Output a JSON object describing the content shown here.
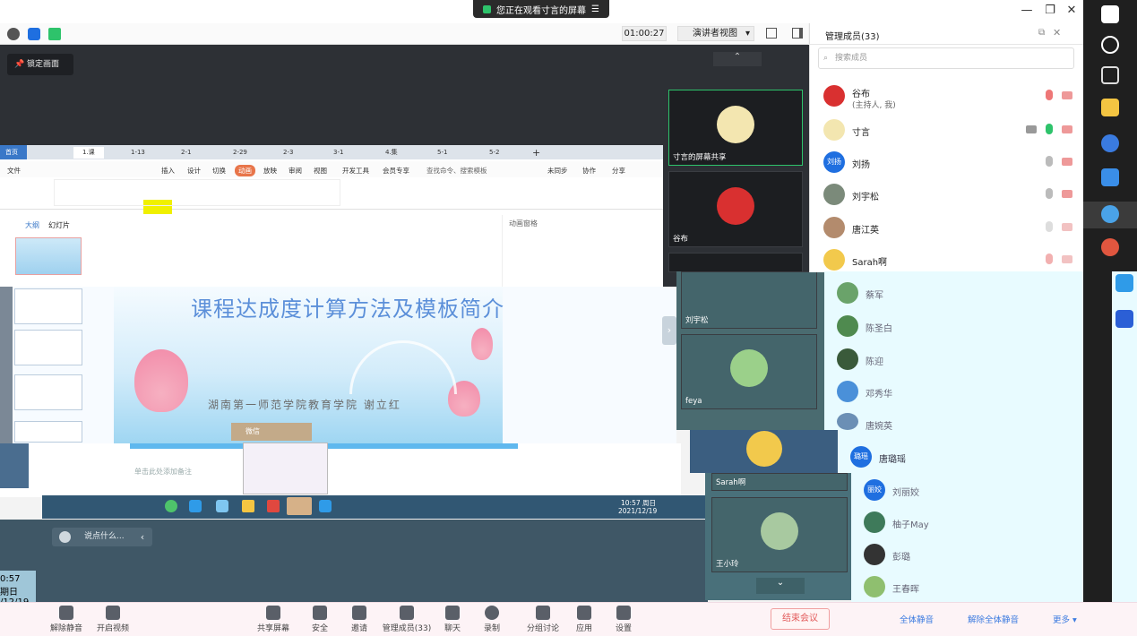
{
  "title_bar": {
    "share_banner": "您正在观看寸言的屏幕",
    "minimize": "—",
    "restore": "❐",
    "close": "✕"
  },
  "toolbar": {
    "timer": "01:00:27",
    "view_mode": "演讲者视图",
    "lock_screen": "锁定画面"
  },
  "members_panel": {
    "title": "管理成员(33)",
    "search_placeholder": "搜索成员",
    "members": [
      {
        "name": "谷布",
        "sub": "(主持人, 我)",
        "avatar_color": "#d93030"
      },
      {
        "name": "寸言",
        "sub": "",
        "avatar_color": "#f3e6b0"
      },
      {
        "name": "刘扬",
        "sub": "",
        "avatar_color": "#1f6fe0"
      },
      {
        "name": "刘宇松",
        "sub": "",
        "avatar_color": "#7b8a7a"
      },
      {
        "name": "唐江英",
        "sub": "",
        "avatar_color": "#b38b6d"
      },
      {
        "name": "Sarah啊",
        "sub": "",
        "avatar_color": "#f2c94c"
      }
    ],
    "members_more": [
      {
        "name": "蔡军",
        "avatar_color": "#6aa36a"
      },
      {
        "name": "陈圣白",
        "avatar_color": "#4f8a4f"
      },
      {
        "name": "陈迎",
        "avatar_color": "#3a5a3a"
      },
      {
        "name": "邓秀华",
        "avatar_color": "#4a90d9"
      },
      {
        "name": "唐婉英",
        "avatar_color": "#6b8fb5"
      }
    ],
    "avatar_text_liuyang": "刘扬",
    "highlighted_member": {
      "name": "唐璐瑶",
      "avatar_text": "璐瑶",
      "avatar_color": "#1f6fe0"
    },
    "members_tail": [
      {
        "name": "刘丽姣",
        "avatar_text": "丽姣",
        "avatar_color": "#1f6fe0"
      },
      {
        "name": "柚子May",
        "avatar_color": "#3e7a5a"
      },
      {
        "name": "彭璐",
        "avatar_color": "#333"
      },
      {
        "name": "王春晖",
        "avatar_color": "#8fbf6f"
      }
    ]
  },
  "video_tiles": [
    {
      "label": "寸言的屏幕共享"
    },
    {
      "label": "谷布"
    },
    {
      "label": "刘宇松"
    },
    {
      "label": "feya"
    },
    {
      "label": "Sarah啊"
    },
    {
      "label": "王小玲"
    }
  ],
  "ppt": {
    "tabs": [
      "首页",
      "1.课",
      "1-13",
      "2-1",
      "2-29",
      "2-3",
      "3-1",
      "4.集",
      "5-1",
      "5-2"
    ],
    "menu": [
      "文件",
      "插入",
      "设计",
      "切换",
      "动画",
      "放映",
      "审阅",
      "视图",
      "开发工具",
      "会员专享",
      "查找命令、搜索模板",
      "未同步",
      "协作",
      "分享"
    ],
    "slide_title": "课程达成度计算方法及模板简介",
    "slide_subtitle": "湖南第一师范学院教育学院 谢立红",
    "outline_tabs": [
      "大纲",
      "幻灯片"
    ],
    "animation_pane": "动画窗格",
    "notes_hint": "单击此处添加备注"
  },
  "chat": {
    "input_placeholder": "说点什么..."
  },
  "inner_clock": {
    "time": "10:57 周日",
    "date": "2021/12/19"
  },
  "left_clock": {
    "time": "0:57",
    "day": "期日",
    "date": "/12/19"
  },
  "bottom_bar": {
    "unmute": "解除静音",
    "video": "开启视频",
    "share": "共享屏幕",
    "security": "安全",
    "invite": "邀请",
    "manage": "管理成员(33)",
    "chat": "聊天",
    "record": "录制",
    "breakout": "分组讨论",
    "apps": "应用",
    "settings": "设置",
    "end": "结束会议",
    "mute_all": "全体静音",
    "unmute_all": "解除全体静音",
    "more": "更多 ▾"
  }
}
